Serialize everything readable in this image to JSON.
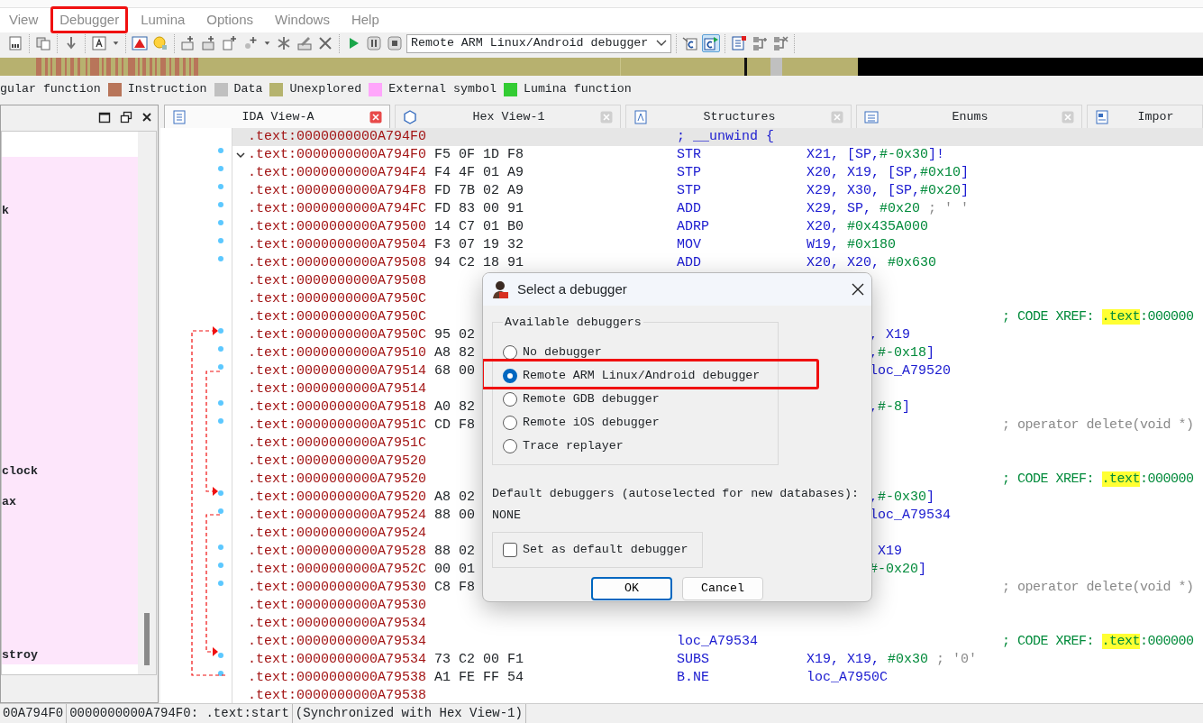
{
  "menu": [
    {
      "label": "View",
      "annotated": false
    },
    {
      "label": "Debugger",
      "annotated": true
    },
    {
      "label": "Lumina",
      "annotated": false
    },
    {
      "label": "Options",
      "annotated": false
    },
    {
      "label": "Windows",
      "annotated": false
    },
    {
      "label": "Help",
      "annotated": false
    }
  ],
  "toolbar": [
    [
      {
        "kind": "binary",
        "pressed": false
      }
    ],
    [
      {
        "kind": "copy",
        "pressed": false
      }
    ],
    [
      {
        "kind": "down",
        "pressed": false
      }
    ],
    [
      {
        "kind": "textbox",
        "pressed": false
      },
      {
        "kind": "caret",
        "pressed": false
      }
    ],
    [
      {
        "kind": "warning",
        "pressed": false
      },
      {
        "kind": "bulb",
        "pressed": false
      }
    ],
    [
      {
        "kind": "addcode",
        "pressed": false
      },
      {
        "kind": "adddata",
        "pressed": false
      },
      {
        "kind": "addtext",
        "pressed": false
      },
      {
        "kind": "addstruct",
        "pressed": false
      },
      {
        "kind": "caret",
        "pressed": false
      },
      {
        "kind": "asterisk",
        "pressed": false
      },
      {
        "kind": "pencil",
        "pressed": false
      },
      {
        "kind": "cross",
        "pressed": false
      }
    ],
    [
      {
        "kind": "play",
        "pressed": false
      },
      {
        "kind": "pause",
        "pressed": false
      },
      {
        "kind": "stop",
        "pressed": false
      },
      {
        "kind": "select",
        "value": "Remote ARM Linux/Android debugger"
      }
    ],
    [
      {
        "kind": "source",
        "pressed": false
      },
      {
        "kind": "sourcerun",
        "pressed": true
      }
    ],
    [
      {
        "kind": "report",
        "pressed": false
      },
      {
        "kind": "nodeadd",
        "pressed": false
      },
      {
        "kind": "nodedel",
        "pressed": false
      }
    ]
  ],
  "legend": [
    {
      "label": "gular function"
    },
    {
      "label": "Instruction",
      "color": "#b8755a"
    },
    {
      "label": "Data",
      "color": "#c0c0c0"
    },
    {
      "label": "Unexplored",
      "color": "#b5b36e"
    },
    {
      "label": "External symbol",
      "color": "#ffa6fb"
    },
    {
      "label": "Lumina function",
      "color": "#33cc33"
    }
  ],
  "functions_panel": {
    "names": [
      "k",
      "clock",
      "ax",
      "stroy"
    ]
  },
  "tabs": [
    {
      "label": "IDA View-A",
      "kind": "disassembly",
      "selected": true
    },
    {
      "label": "Hex View-1",
      "kind": "hex",
      "selected": false
    },
    {
      "label": "Structures",
      "kind": "structures",
      "selected": false
    },
    {
      "label": "Enums",
      "kind": "enums",
      "selected": false
    },
    {
      "label": "Impor",
      "kind": "imports",
      "selected": false
    }
  ],
  "code": {
    "lines": [
      {
        "address": ".text:0000000000A794F0",
        "mnemonic": "; __unwind {",
        "selected": true
      },
      {
        "address": ".text:0000000000A794F0",
        "bytes": "F5 0F 1D F8",
        "mnemonic": "STR",
        "operands": [
          {
            "text": "X21, [SP,",
            "kind": "reg"
          },
          {
            "text": "#-0x30",
            "kind": "num"
          },
          {
            "text": "]!",
            "kind": "reg"
          }
        ],
        "selected": false,
        "expanded": true
      },
      {
        "address": ".text:0000000000A794F4",
        "bytes": "F4 4F 01 A9",
        "mnemonic": "STP",
        "operands": [
          {
            "text": "X20, X19, [SP,",
            "kind": "reg"
          },
          {
            "text": "#0x10",
            "kind": "num"
          },
          {
            "text": "]",
            "kind": "reg"
          }
        ],
        "selected": false
      },
      {
        "address": ".text:0000000000A794F8",
        "bytes": "FD 7B 02 A9",
        "mnemonic": "STP",
        "operands": [
          {
            "text": "X29, X30, [SP,",
            "kind": "reg"
          },
          {
            "text": "#0x20",
            "kind": "num"
          },
          {
            "text": "]",
            "kind": "reg"
          }
        ],
        "selected": false
      },
      {
        "address": ".text:0000000000A794FC",
        "bytes": "FD 83 00 91",
        "mnemonic": "ADD",
        "operands": [
          {
            "text": "X29, SP, ",
            "kind": "reg"
          },
          {
            "text": "#0x20",
            "kind": "num"
          },
          {
            "text": " ; ' '",
            "kind": "note"
          }
        ],
        "selected": false
      },
      {
        "address": ".text:0000000000A79500",
        "bytes": "14 C7 01 B0",
        "mnemonic": "ADRP",
        "operands": [
          {
            "text": "X20, ",
            "kind": "reg"
          },
          {
            "text": "#0x435A000",
            "kind": "num"
          }
        ],
        "selected": false
      },
      {
        "address": ".text:0000000000A79504",
        "bytes": "F3 07 19 32",
        "mnemonic": "MOV",
        "operands": [
          {
            "text": "W19, ",
            "kind": "reg"
          },
          {
            "text": "#0x180",
            "kind": "num"
          }
        ],
        "selected": false
      },
      {
        "address": ".text:0000000000A79508",
        "bytes": "94 C2 18 91",
        "mnemonic": "ADD",
        "operands": [
          {
            "text": "X20, X20, ",
            "kind": "reg"
          },
          {
            "text": "#0x630",
            "kind": "num"
          }
        ],
        "selected": false
      },
      {
        "address": ".text:0000000000A79508",
        "selected": false
      },
      {
        "address": ".text:0000000000A7950C",
        "selected": false
      },
      {
        "address": ".text:0000000000A7950C",
        "comment": {
          "kind": "xref",
          "parts": [
            {
              "text": "; CODE XREF: ",
              "highlighted": false
            },
            {
              "text": ".text",
              "highlighted": true
            },
            {
              "text": ":000000",
              "highlighted": false
            }
          ]
        },
        "selected": false
      },
      {
        "address": ".text:0000000000A7950C",
        "bytes": "95 02",
        "operands_tail": [
          {
            "text": ", X19",
            "kind": "reg"
          }
        ],
        "selected": false
      },
      {
        "address": ".text:0000000000A79510",
        "bytes": "A8 82",
        "operands_tail": [
          {
            "text": ",",
            "kind": "reg"
          },
          {
            "text": "#-0x18",
            "kind": "num"
          },
          {
            "text": "]",
            "kind": "reg"
          }
        ],
        "selected": false
      },
      {
        "address": ".text:0000000000A79514",
        "bytes": "68 00",
        "operands_tail": [
          {
            "text": "loc_A79520",
            "kind": "reg"
          }
        ],
        "selected": false
      },
      {
        "address": ".text:0000000000A79514",
        "selected": false
      },
      {
        "address": ".text:0000000000A79518",
        "bytes": "A0 82",
        "operands_tail": [
          {
            "text": ",",
            "kind": "reg"
          },
          {
            "text": "#-8",
            "kind": "num"
          },
          {
            "text": "]",
            "kind": "reg"
          }
        ],
        "selected": false
      },
      {
        "address": ".text:0000000000A7951C",
        "bytes": "CD F8",
        "comment": {
          "kind": "note",
          "parts": [
            {
              "text": "; operator delete(void *)",
              "highlighted": false
            }
          ]
        },
        "selected": false
      },
      {
        "address": ".text:0000000000A7951C",
        "selected": false
      },
      {
        "address": ".text:0000000000A79520",
        "selected": false
      },
      {
        "address": ".text:0000000000A79520",
        "comment": {
          "kind": "xref",
          "parts": [
            {
              "text": "; CODE XREF: ",
              "highlighted": false
            },
            {
              "text": ".text",
              "highlighted": true
            },
            {
              "text": ":000000",
              "highlighted": false
            }
          ]
        },
        "selected": false
      },
      {
        "address": ".text:0000000000A79520",
        "bytes": "A8 02",
        "operands_tail": [
          {
            "text": ",",
            "kind": "reg"
          },
          {
            "text": "#-0x30",
            "kind": "num"
          },
          {
            "text": "]",
            "kind": "reg"
          }
        ],
        "selected": false
      },
      {
        "address": ".text:0000000000A79524",
        "bytes": "88 00",
        "operands_tail": [
          {
            "text": "loc_A79534",
            "kind": "reg"
          }
        ],
        "selected": false
      },
      {
        "address": ".text:0000000000A79524",
        "selected": false
      },
      {
        "address": ".text:0000000000A79528",
        "bytes": "88 02",
        "operands_tail": [
          {
            "text": " X19",
            "kind": "reg"
          }
        ],
        "selected": false
      },
      {
        "address": ".text:0000000000A7952C",
        "bytes": "00 01",
        "operands_tail": [
          {
            "text": "#-0x20",
            "kind": "num"
          },
          {
            "text": "]",
            "kind": "reg"
          }
        ],
        "selected": false
      },
      {
        "address": ".text:0000000000A79530",
        "bytes": "C8 F8",
        "comment": {
          "kind": "note",
          "parts": [
            {
              "text": "; operator delete(void *)",
              "highlighted": false
            }
          ]
        },
        "selected": false
      },
      {
        "address": ".text:0000000000A79530",
        "selected": false
      },
      {
        "address": ".text:0000000000A79534",
        "selected": false
      },
      {
        "address": ".text:0000000000A79534",
        "mnemonic": "loc_A79534",
        "comment": {
          "kind": "xref",
          "parts": [
            {
              "text": "; CODE XREF: ",
              "highlighted": false
            },
            {
              "text": ".text",
              "highlighted": true
            },
            {
              "text": ":000000",
              "highlighted": false
            }
          ]
        },
        "selected": false
      },
      {
        "address": ".text:0000000000A79534",
        "bytes": "73 C2 00 F1",
        "mnemonic": "SUBS",
        "operands": [
          {
            "text": "X19, X19, ",
            "kind": "reg"
          },
          {
            "text": "#0x30",
            "kind": "num"
          },
          {
            "text": " ; '0'",
            "kind": "note"
          }
        ],
        "selected": false
      },
      {
        "address": ".text:0000000000A79538",
        "bytes": "A1 FE FF 54",
        "mnemonic": "B.NE",
        "operands": [
          {
            "text": "loc_A7950C",
            "kind": "reg"
          }
        ],
        "selected": false
      },
      {
        "address": ".text:0000000000A79538",
        "selected": false
      }
    ]
  },
  "status_bar": [
    "00A794F0",
    "0000000000A794F0: .text:start",
    "(Synchronized with Hex View-1)"
  ],
  "dialog": {
    "title": "Select a debugger",
    "group_label": "Available debuggers",
    "options": [
      {
        "label": "No debugger",
        "selected": false,
        "annotated": false
      },
      {
        "label": "Remote ARM Linux/Android debugger",
        "selected": true,
        "annotated": true
      },
      {
        "label": "Remote GDB debugger",
        "selected": false,
        "annotated": false
      },
      {
        "label": "Remote iOS debugger",
        "selected": false,
        "annotated": false
      },
      {
        "label": "Trace replayer",
        "selected": false,
        "annotated": false
      }
    ],
    "default_label": "Default debuggers (autoselected for new databases):",
    "default_value": "NONE",
    "checkbox": {
      "label": "Set as default debugger",
      "checked": false
    },
    "buttons": [
      {
        "label": "OK",
        "kind": "default"
      },
      {
        "label": "Cancel",
        "kind": "normal"
      }
    ]
  }
}
